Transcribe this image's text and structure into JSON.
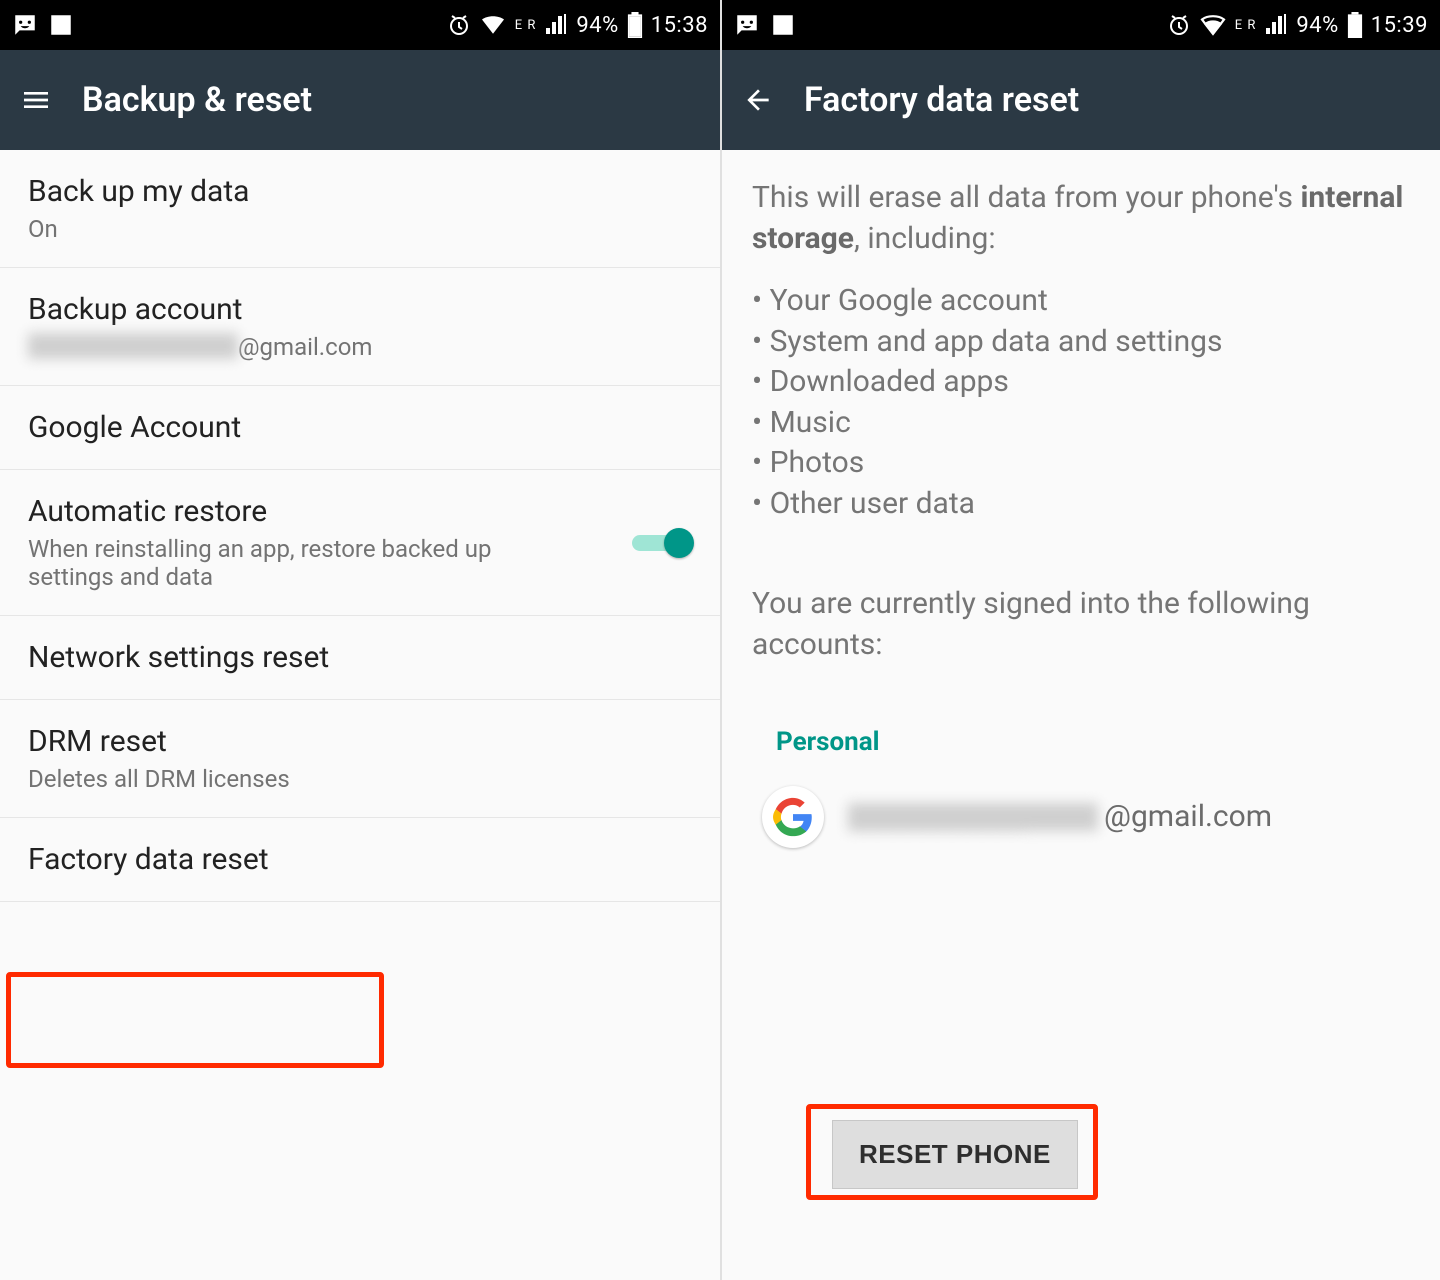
{
  "left": {
    "status": {
      "network_label": "E R",
      "battery_text": "94%",
      "time": "15:38"
    },
    "app_title": "Backup & reset",
    "items": {
      "backup_data": {
        "title": "Back up my data",
        "subtitle": "On"
      },
      "backup_account": {
        "title": "Backup account",
        "suffix": "@gmail.com"
      },
      "google_account": {
        "title": "Google Account"
      },
      "auto_restore": {
        "title": "Automatic restore",
        "subtitle": "When reinstalling an app, restore backed up settings and data"
      },
      "network_reset": {
        "title": "Network settings reset"
      },
      "drm_reset": {
        "title": "DRM reset",
        "subtitle": "Deletes all DRM licenses"
      },
      "factory_reset": {
        "title": "Factory data reset"
      }
    }
  },
  "right": {
    "status": {
      "network_label": "E R",
      "battery_text": "94%",
      "time": "15:39"
    },
    "app_title": "Factory data reset",
    "intro_prefix": "This will erase all data from your phone's ",
    "intro_bold": "internal storage",
    "intro_suffix": ", including:",
    "bullets": [
      "• Your Google account",
      "• System and app data and settings",
      "• Downloaded apps",
      "• Music",
      "• Photos",
      "• Other user data"
    ],
    "signed_text": "You are currently signed into the following accounts:",
    "personal_label": "Personal",
    "account_suffix": "@gmail.com",
    "reset_button": "RESET PHONE"
  }
}
